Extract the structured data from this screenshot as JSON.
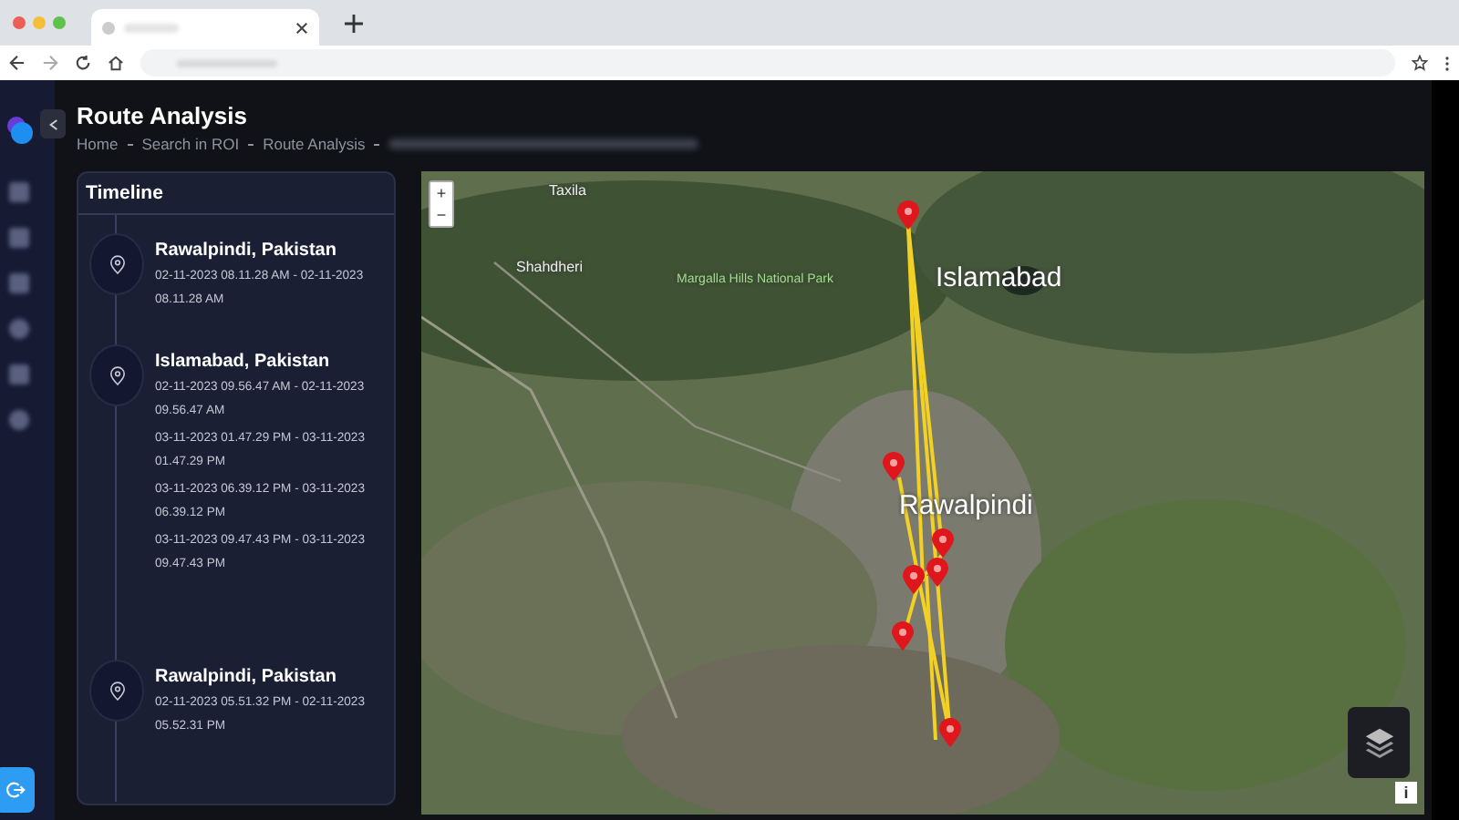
{
  "page": {
    "title": "Route Analysis"
  },
  "breadcrumb": [
    {
      "label": "Home"
    },
    {
      "label": "Search in ROI"
    },
    {
      "label": "Route Analysis"
    }
  ],
  "timeline": {
    "title": "Timeline",
    "entries": [
      {
        "place": "Rawalpindi, Pakistan",
        "times": [
          "02-11-2023 08.11.28 AM - 02-11-2023 08.11.28 AM"
        ]
      },
      {
        "place": "Islamabad, Pakistan",
        "times": [
          "02-11-2023 09.56.47 AM - 02-11-2023 09.56.47 AM",
          "03-11-2023 01.47.29 PM - 03-11-2023 01.47.29 PM",
          "03-11-2023 06.39.12 PM - 03-11-2023 06.39.12 PM",
          "03-11-2023 09.47.43 PM - 03-11-2023 09.47.43 PM"
        ]
      },
      {
        "place": "Rawalpindi, Pakistan",
        "times": [
          "02-11-2023 05.51.32 PM - 02-11-2023 05.52.31 PM"
        ]
      }
    ]
  },
  "map": {
    "zoom_in": "+",
    "zoom_out": "−",
    "info": "i",
    "labels": [
      {
        "text": "Taxila",
        "kind": "town"
      },
      {
        "text": "Shahdheri",
        "kind": "town"
      },
      {
        "text": "Margalla Hills National Park",
        "kind": "park"
      },
      {
        "text": "Islamabad",
        "kind": "city"
      },
      {
        "text": "Rawalpindi",
        "kind": "city"
      }
    ]
  }
}
